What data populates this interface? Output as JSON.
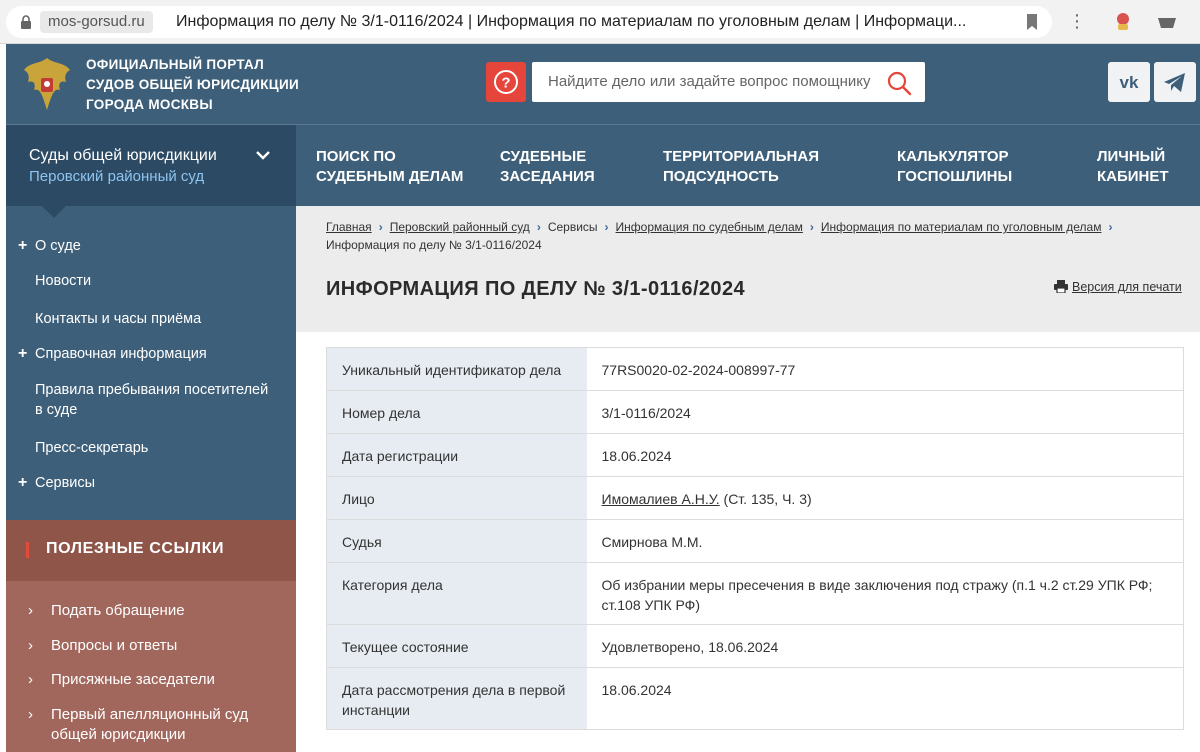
{
  "browser": {
    "domain": "mos-gorsud.ru",
    "tab_title": "Информация по делу № 3/1-0116/2024 | Информация по материалам по уголовным делам | Информаци..."
  },
  "header": {
    "portal_name": [
      "Официальный портал",
      "судов общей юрисдикции",
      "города Москвы"
    ],
    "help_icon": "question-circle-icon",
    "search_placeholder": "Найдите дело или задайте вопрос помощнику",
    "social": [
      "vk",
      "telegram"
    ]
  },
  "nav": {
    "court_selector": {
      "title": "Суды общей юрисдикции",
      "selected": "Перовский районный суд"
    },
    "items": [
      {
        "line1": "Поиск по",
        "line2": "судебным делам"
      },
      {
        "line1": "Судебные",
        "line2": "заседания"
      },
      {
        "line1": "Территориальная",
        "line2": "подсудность"
      },
      {
        "line1": "Калькулятор",
        "line2": "госпошлины"
      },
      {
        "line1": "Личный",
        "line2": "кабинет"
      }
    ]
  },
  "sidebar": {
    "items": [
      {
        "label": "О суде",
        "expandable": true
      },
      {
        "label": "Новости",
        "expandable": false
      },
      {
        "label": "Контакты и часы приёма",
        "expandable": false
      },
      {
        "label": "Справочная информация",
        "expandable": true
      },
      {
        "label": "Правила пребывания посетителей в суде",
        "expandable": false
      },
      {
        "label": "Пресс-секретарь",
        "expandable": false
      },
      {
        "label": "Сервисы",
        "expandable": true
      }
    ],
    "useful_links_title": "Полезные ссылки",
    "useful_links": [
      "Подать обращение",
      "Вопросы и ответы",
      "Присяжные заседатели",
      "Первый апелляционный суд общей юрисдикции"
    ]
  },
  "breadcrumb": {
    "links": [
      "Главная",
      "Перовский районный суд",
      "Сервисы",
      "Информация по судебным делам",
      "Информация по материалам по уголовным делам"
    ],
    "current": "Информация по делу № 3/1-0116/2024"
  },
  "page": {
    "title": "Информация по делу № 3/1-0116/2024",
    "print_label": "Версия для печати"
  },
  "case": {
    "rows": [
      {
        "key": "Уникальный идентификатор дела",
        "value": "77RS0020-02-2024-008997-77"
      },
      {
        "key": "Номер дела",
        "value": "3/1-0116/2024"
      },
      {
        "key": "Дата регистрации",
        "value": "18.06.2024"
      },
      {
        "key": "Лицо",
        "value_link": "Имомалиев А.Н.У.",
        "value": " (Ст. 135, Ч. 3)"
      },
      {
        "key": "Судья",
        "value": "Смирнова М.М."
      },
      {
        "key": "Категория дела",
        "value": "Об избрании меры пресечения в виде заключения под стражу (п.1 ч.2 ст.29 УПК РФ; ст.108 УПК РФ)"
      },
      {
        "key": "Текущее состояние",
        "value": "Удовлетворено, 18.06.2024"
      },
      {
        "key": "Дата рассмотрения дела в первой инстанции",
        "value": "18.06.2024"
      }
    ]
  },
  "colors": {
    "header_bg": "#3e5f79",
    "nav_dark": "#2c4a63",
    "accent_red": "#e5453a",
    "useful_bg": "#a2675c",
    "table_key_bg": "#e6ecf2"
  }
}
